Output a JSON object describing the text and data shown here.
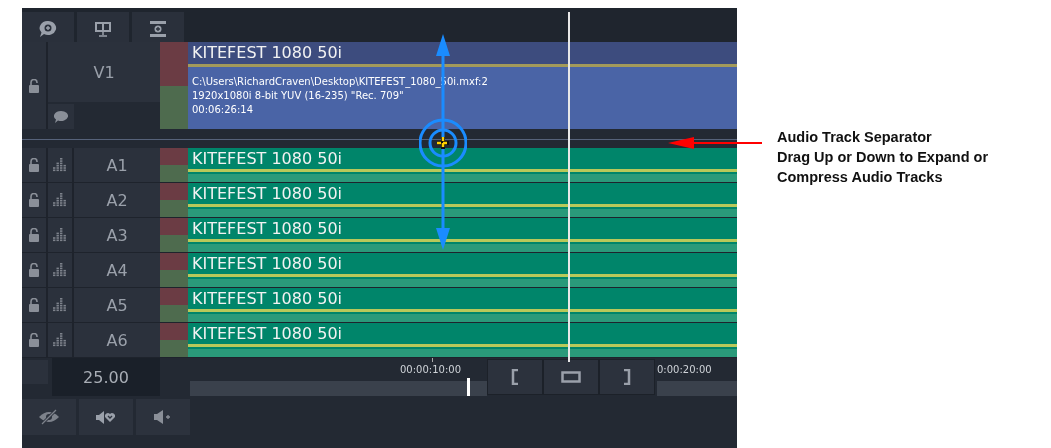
{
  "video_track": {
    "label": "V1",
    "clip": {
      "title": "KITEFEST 1080 50i",
      "path": "C:\\Users\\RichardCraven\\Desktop\\KITEFEST_1080_50i.mxf:2",
      "format": "1920x1080i 8-bit YUV (16-235) \"Rec. 709\"",
      "duration": "00:06:26:14"
    }
  },
  "audio_tracks": [
    {
      "label": "A1",
      "clip_title": "KITEFEST 1080 50i"
    },
    {
      "label": "A2",
      "clip_title": "KITEFEST 1080 50i"
    },
    {
      "label": "A3",
      "clip_title": "KITEFEST 1080 50i"
    },
    {
      "label": "A4",
      "clip_title": "KITEFEST 1080 50i"
    },
    {
      "label": "A5",
      "clip_title": "KITEFEST 1080 50i"
    },
    {
      "label": "A6",
      "clip_title": "KITEFEST 1080 50i"
    }
  ],
  "frame_rate": "25.00",
  "ruler": {
    "timecodes": [
      "00:00:10:00",
      "0:00:20:00"
    ]
  },
  "annotation": {
    "title": "Audio Track Separator",
    "description": [
      "Drag Up or Down to Expand or",
      "Compress Audio Tracks"
    ]
  }
}
